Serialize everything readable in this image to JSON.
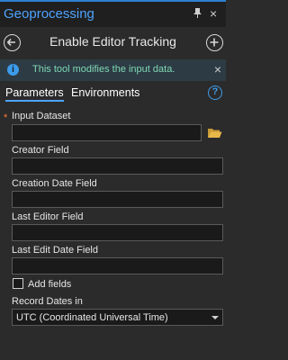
{
  "window": {
    "title": "Geoprocessing",
    "pin_glyph": "⬇",
    "close_glyph": "×"
  },
  "tool": {
    "title": "Enable Editor Tracking",
    "back_icon": "back-arrow-icon",
    "add_icon": "add-icon"
  },
  "info_bar": {
    "icon_glyph": "i",
    "message": "This tool modifies the input data.",
    "close_glyph": "×"
  },
  "tabs": [
    {
      "label": "Parameters",
      "active": true
    },
    {
      "label": "Environments",
      "active": false
    }
  ],
  "help_glyph": "?",
  "params": {
    "required_mark": "*",
    "input_dataset_label": "Input Dataset",
    "creator_field_label": "Creator Field",
    "creation_date_field_label": "Creation Date Field",
    "last_editor_field_label": "Last Editor Field",
    "last_edit_date_field_label": "Last Edit Date Field",
    "add_fields_label": "Add fields",
    "record_dates_label": "Record Dates in",
    "record_dates_value": "UTC (Coordinated Universal Time)"
  },
  "colors": {
    "accent": "#4da3ff",
    "info_text": "#7fd8b4",
    "required": "#ff7a3a",
    "folder": "#e8b84a"
  }
}
